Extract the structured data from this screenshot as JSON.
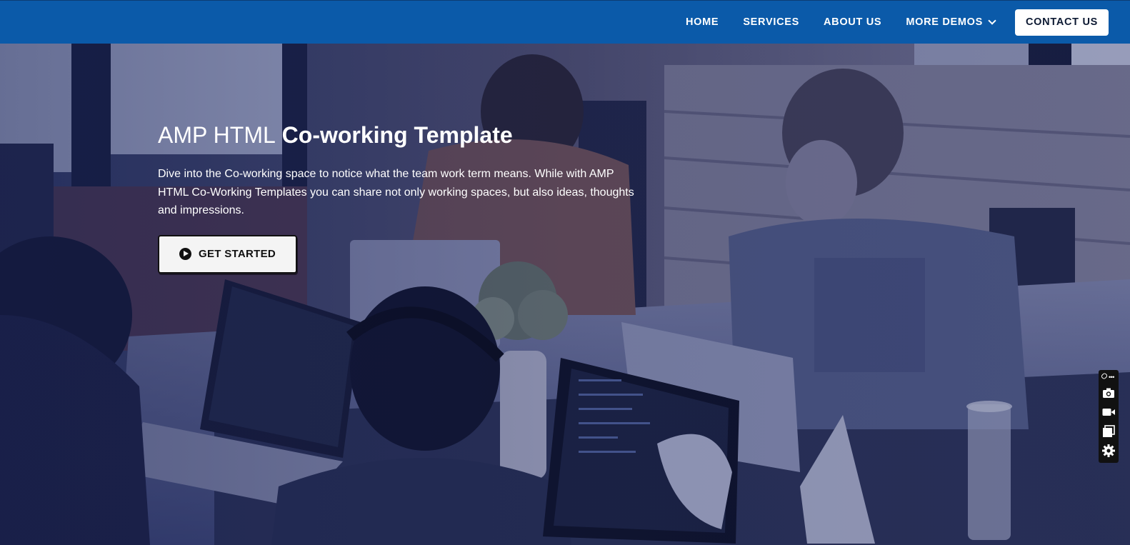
{
  "nav": {
    "items": [
      {
        "label": "HOME"
      },
      {
        "label": "SERVICES"
      },
      {
        "label": "ABOUT US"
      },
      {
        "label": "MORE DEMOS"
      }
    ],
    "contact_label": "CONTACT US",
    "bar_color": "#0b5aa9"
  },
  "hero": {
    "title_light": "AMP HTML",
    "title_bold": "Co-working Template",
    "description": "Dive into the Co-working space to notice what the team work term means. While with AMP HTML Co-Working Templates you can share not only working spaces, but also ideas, thoughts and impressions.",
    "cta_label": "GET STARTED",
    "cta_icon": "play-circle-icon",
    "overlay_color": "#161e50"
  },
  "toolbar": {
    "icons": [
      "link-icon",
      "more-icon",
      "camera-icon",
      "video-icon",
      "window-icon",
      "settings-icon"
    ]
  }
}
